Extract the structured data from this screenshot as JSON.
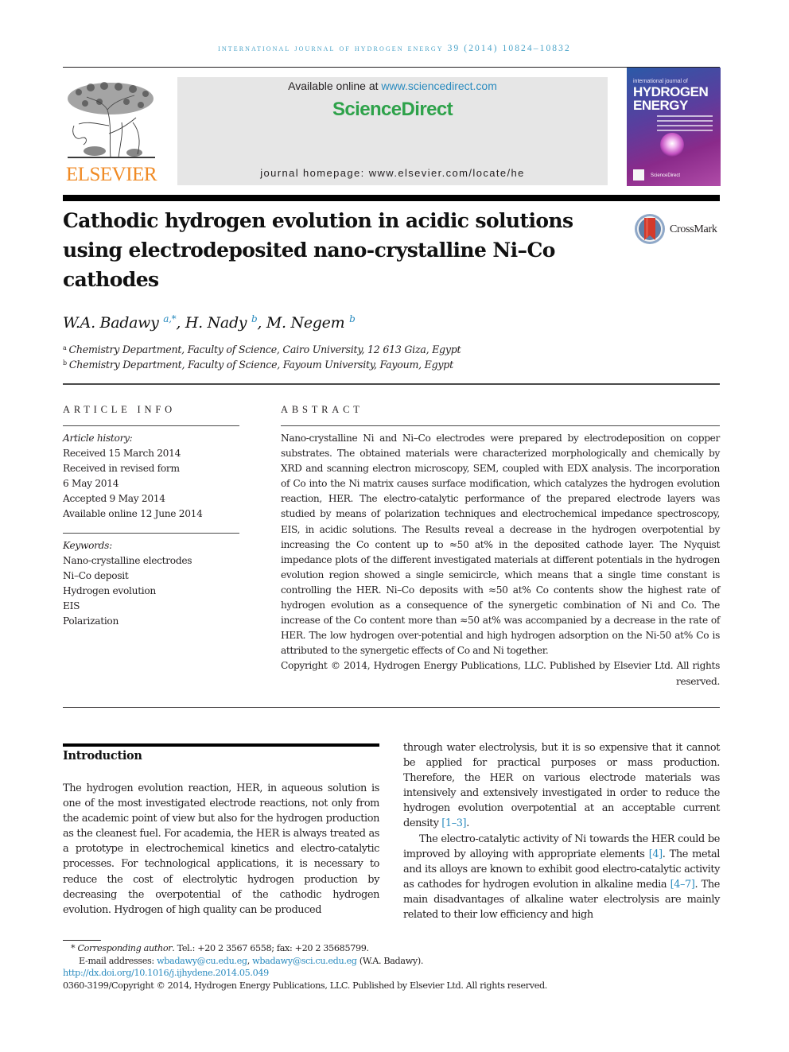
{
  "running_header": "International Journal of Hydrogen Energy 39 (2014) 10824–10832",
  "publisher": {
    "logo_word": "ELSEVIER",
    "brand_color": "#f08a24"
  },
  "banner": {
    "available_prefix": "Available online at ",
    "available_link": "www.sciencedirect.com",
    "sciencedirect_logo": "ScienceDirect",
    "sciencedirect_color": "#2ea24a",
    "homepage_label": "journal homepage: ",
    "homepage_url": "www.elsevier.com/locate/he"
  },
  "journal_cover": {
    "top_line": "international journal of",
    "title_line1": "HYDROGEN",
    "title_line2": "ENERGY",
    "footer": "ScienceDirect"
  },
  "article": {
    "title": "Cathodic hydrogen evolution in acidic solutions using electrodeposited nano-crystalline Ni–Co cathodes",
    "crossmark_label": "CrossMark",
    "authors": [
      {
        "name": "W.A. Badawy",
        "sup": "a,*"
      },
      {
        "name": "H. Nady",
        "sup": "b"
      },
      {
        "name": "M. Negem",
        "sup": "b"
      }
    ],
    "affiliations": [
      {
        "mark": "a",
        "text": "Chemistry Department, Faculty of Science, Cairo University, 12 613 Giza, Egypt"
      },
      {
        "mark": "b",
        "text": "Chemistry Department, Faculty of Science, Fayoum University, Fayoum, Egypt"
      }
    ]
  },
  "article_info": {
    "label": "ARTICLE INFO",
    "history_label": "Article history:",
    "history": [
      "Received 15 March 2014",
      "Received in revised form",
      "6 May 2014",
      "Accepted 9 May 2014",
      "Available online 12 June 2014"
    ],
    "keywords_label": "Keywords:",
    "keywords": [
      "Nano-crystalline electrodes",
      "Ni–Co deposit",
      "Hydrogen evolution",
      "EIS",
      "Polarization"
    ]
  },
  "abstract": {
    "label": "ABSTRACT",
    "text": "Nano-crystalline Ni and Ni–Co electrodes were prepared by electrodeposition on copper substrates. The obtained materials were characterized morphologically and chemically by XRD and scanning electron microscopy, SEM, coupled with EDX analysis. The incorporation of Co into the Ni matrix causes surface modification, which catalyzes the hydrogen evolution reaction, HER. The electro-catalytic performance of the prepared electrode layers was studied by means of polarization techniques and electrochemical impedance spectroscopy, EIS, in acidic solutions. The Results reveal a decrease in the hydrogen overpotential by increasing the Co content up to ≈50 at% in the deposited cathode layer. The Nyquist impedance plots of the different investigated materials at different potentials in the hydrogen evolution region showed a single semicircle, which means that a single time constant is controlling the HER. Ni–Co deposits with ≈50 at% Co contents show the highest rate of hydrogen evolution as a consequence of the synergetic combination of Ni and Co. The increase of the Co content more than ≈50 at% was accompanied by a decrease in the rate of HER. The low hydrogen over-potential and high hydrogen adsorption on the Ni-50 at% Co is attributed to the synergetic effects of Co and Ni together.",
    "copyright": "Copyright © 2014, Hydrogen Energy Publications, LLC. Published by Elsevier Ltd. All rights reserved."
  },
  "introduction": {
    "heading": "Introduction",
    "para1": "The hydrogen evolution reaction, HER, in aqueous solution is one of the most investigated electrode reactions, not only from the academic point of view but also for the hydrogen production as the cleanest fuel. For academia, the HER is always treated as a prototype in electrochemical kinetics and electro-catalytic processes. For technological applications, it is necessary to reduce the cost of electrolytic hydrogen production by decreasing the overpotential of the cathodic hydrogen evolution. Hydrogen of high quality can be produced",
    "para1_cont": "through water electrolysis, but it is so expensive that it cannot be applied for practical purposes or mass production. Therefore, the HER on various electrode materials was intensively and extensively investigated in order to reduce the hydrogen evolution overpotential at an acceptable current density ",
    "ref_1_3": "[1–3]",
    "para2_a": "The electro-catalytic activity of Ni towards the HER could be improved by alloying with appropriate elements ",
    "ref_4": "[4]",
    "para2_b": ". The metal and its alloys are known to exhibit good electro-catalytic activity as cathodes for hydrogen evolution in alkaline media ",
    "ref_4_7": "[4–7]",
    "para2_c": ". The main disadvantages of alkaline water electrolysis are mainly related to their low efficiency and high"
  },
  "footnotes": {
    "corr_mark": "* ",
    "corr_label": "Corresponding author",
    "corr_text": ". Tel.: +20 2 3567 6558; fax: +20 2 35685799.",
    "email_label": "E-mail addresses: ",
    "email_1": "wbadawy@cu.edu.eg",
    "email_sep": ", ",
    "email_2": "wbadawy@sci.cu.edu.eg",
    "email_owner": " (W.A. Badawy).",
    "doi": "http://dx.doi.org/10.1016/j.ijhydene.2014.05.049",
    "issn_copyright": "0360-3199/Copyright © 2014, Hydrogen Energy Publications, LLC. Published by Elsevier Ltd. All rights reserved."
  }
}
